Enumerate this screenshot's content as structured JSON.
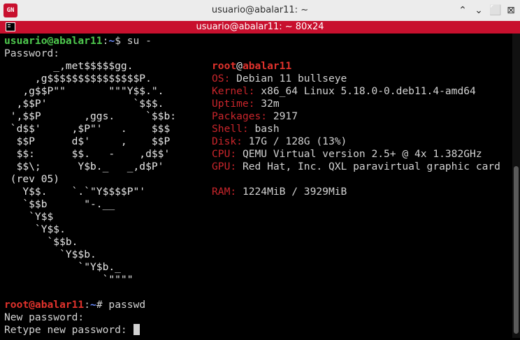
{
  "window": {
    "title": "usuario@abalar11: ~",
    "tab_title": "usuario@abalar11: ~ 80x24",
    "app_icon_label": "GN",
    "minimize_symbol": "⌃",
    "maximize_symbol": "⌄",
    "restore_symbol": "⬜",
    "close_symbol": "⊠"
  },
  "prompt1": {
    "user": "usuario@abalar11",
    "sep": ":",
    "path": "~",
    "dollar": "$ ",
    "cmd": "su -"
  },
  "password_label": "Password:",
  "art": [
    "        _,met$$$$$gg.",
    "     ,g$$$$$$$$$$$$$$$P.",
    "   ,g$$P\"\"       \"\"\"Y$$.\".",
    "  ,$$P'              `$$$.",
    " ',$$P       ,ggs.     `$$b:",
    " `d$$'     ,$P\"'   .    $$$",
    "  $$P      d$'     ,    $$P",
    "  $$:      $$.   -    ,d$$'",
    "  $$\\;      Y$b._   _,d$P'",
    " (rev 05)",
    "   Y$$.    `.`\"Y$$$$P\"'",
    "   `$$b      \"-.__",
    "    `Y$$",
    "     `Y$$.",
    "       `$$b.",
    "         `Y$$b.",
    "            `\"Y$b._",
    "                `\"\"\"\""
  ],
  "info": {
    "user": "root",
    "at": "@",
    "host": "abalar11",
    "os_key": "OS:",
    "os_val": " Debian 11 bullseye",
    "kernel_key": "Kernel:",
    "kernel_val": " x86_64 Linux 5.18.0-0.deb11.4-amd64",
    "uptime_key": "Uptime:",
    "uptime_val": " 32m",
    "packages_key": "Packages:",
    "packages_val": " 2917",
    "shell_key": "Shell:",
    "shell_val": " bash",
    "disk_key": "Disk:",
    "disk_val": " 17G / 128G (13%)",
    "cpu_key": "CPU:",
    "cpu_val": " QEMU Virtual version 2.5+ @ 4x 1.382GHz",
    "gpu_key": "GPU:",
    "gpu_val": " Red Hat, Inc. QXL paravirtual graphic card",
    "ram_key": "RAM:",
    "ram_val": " 1224MiB / 3929MiB"
  },
  "prompt2": {
    "user": "root@abalar11",
    "sep": ":",
    "path": "~",
    "hash": "# ",
    "cmd": "passwd"
  },
  "new_password_label": "New password:",
  "retype_label": "Retype new password: "
}
